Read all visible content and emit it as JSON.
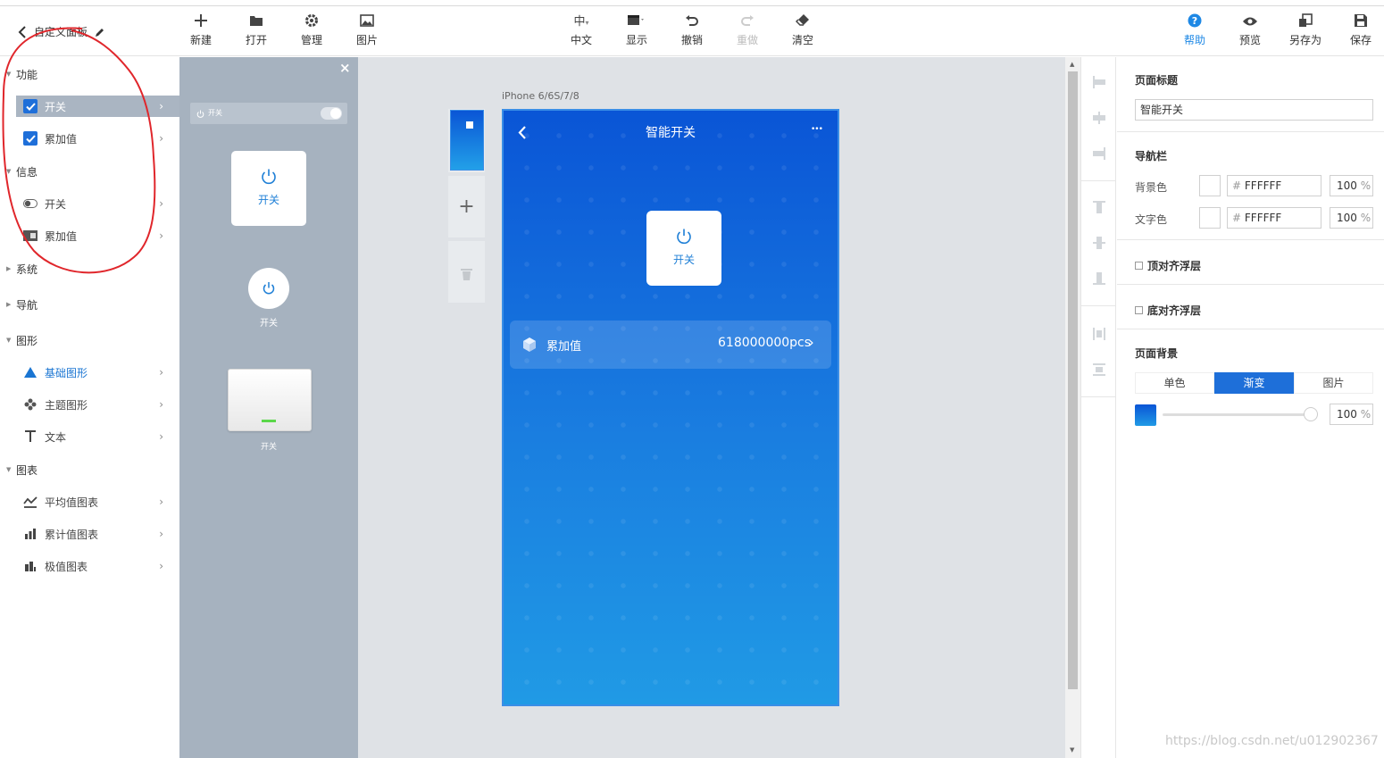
{
  "toolbar": {
    "panel_title": "自定义面板",
    "left_buttons": [
      "新建",
      "打开",
      "管理",
      "图片"
    ],
    "center_buttons": [
      "中文",
      "显示",
      "撤销",
      "重做",
      "清空"
    ],
    "center_glyphs": [
      "中",
      "",
      ""
    ],
    "right_buttons": [
      "帮助",
      "预览",
      "另存为",
      "保存"
    ]
  },
  "sidebar": {
    "sections": [
      "功能",
      "信息",
      "系统",
      "导航",
      "图形",
      "图表"
    ],
    "func_items": [
      "开关",
      "累加值"
    ],
    "info_items": [
      "开关",
      "累加值"
    ],
    "shape_items": [
      "基础图形",
      "主题图形",
      "文本"
    ],
    "chart_items": [
      "平均值图表",
      "累计值图表",
      "极值图表"
    ]
  },
  "widget_panel": {
    "close": "×",
    "mini_label": "开关",
    "card_label": "开关",
    "round_label": "开关",
    "wall_label": "开关"
  },
  "canvas": {
    "device_label": "iPhone 6/6S/7/8",
    "add_page": "+",
    "phone_title": "智能开关",
    "more": "•••",
    "switch_label": "开关",
    "counter_label": "累加值",
    "counter_value": "618000000pcs",
    "chevron": "›"
  },
  "props": {
    "page_title_label": "页面标题",
    "page_title_value": "智能开关",
    "navbar_label": "导航栏",
    "bg_color_label": "背景色",
    "bg_color_value": "FFFFFF",
    "bg_opacity": "100",
    "text_color_label": "文字色",
    "text_color_value": "FFFFFF",
    "text_opacity": "100",
    "hash": "#",
    "percent": "%",
    "top_float": "顶对齐浮层",
    "bottom_float": "底对齐浮层",
    "page_bg_label": "页面背景",
    "bg_tabs": [
      "单色",
      "渐变",
      "图片"
    ],
    "bg_tab_active": "渐变",
    "gradient_opacity": "100"
  },
  "colors": {
    "accent": "#1e6fd9",
    "phone_top": "#0a55d6",
    "phone_bottom": "#209ae5",
    "sidebar_selected": "#aab5c2",
    "panel_bg": "#a6b2bf"
  },
  "icons": [
    "chevron-left-icon",
    "pencil-icon",
    "plus-icon",
    "folder-icon",
    "gear-icon",
    "image-icon",
    "undo-icon",
    "redo-icon",
    "eraser-icon",
    "help-icon",
    "eye-icon",
    "save-as-icon",
    "save-icon",
    "power-icon",
    "cube-icon",
    "trash-icon"
  ],
  "watermark": "https://blog.csdn.net/u012902367"
}
